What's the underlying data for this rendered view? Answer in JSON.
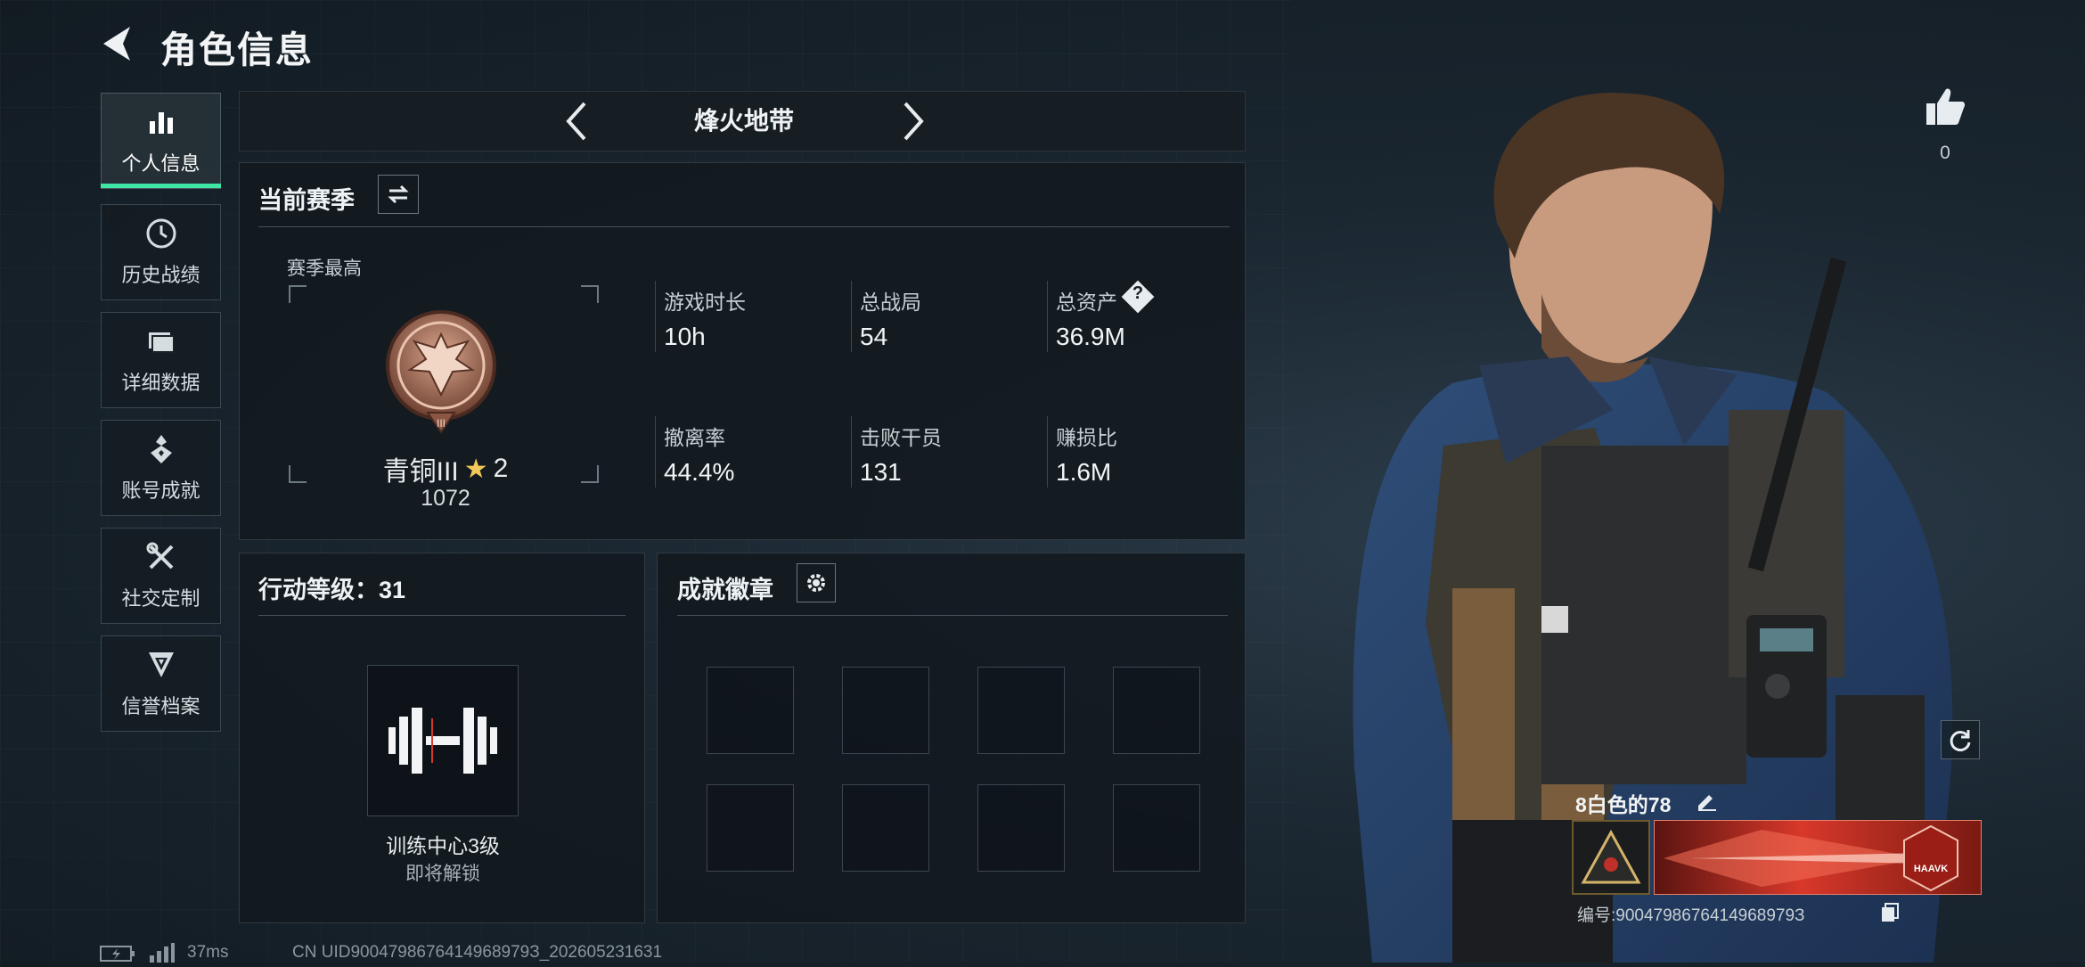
{
  "header": {
    "title": "角色信息"
  },
  "sidebar": {
    "items": [
      {
        "label": "个人信息",
        "icon": "bar-chart-icon"
      },
      {
        "label": "历史战绩",
        "icon": "clock-icon"
      },
      {
        "label": "详细数据",
        "icon": "folder-icon"
      },
      {
        "label": "账号成就",
        "icon": "medal-icon"
      },
      {
        "label": "社交定制",
        "icon": "tools-icon"
      },
      {
        "label": "信誉档案",
        "icon": "shield-icon"
      }
    ]
  },
  "mode": {
    "title": "烽火地带"
  },
  "season": {
    "title": "当前赛季",
    "best_label": "赛季最高",
    "rank_name": "青铜III",
    "rank_stars": "2",
    "rank_points": "1072",
    "stats": [
      {
        "label": "游戏时长",
        "value": "10h"
      },
      {
        "label": "总战局",
        "value": "54"
      },
      {
        "label": "总资产",
        "value": "36.9M"
      },
      {
        "label": "撤离率",
        "value": "44.4%"
      },
      {
        "label": "击败干员",
        "value": "131"
      },
      {
        "label": "赚损比",
        "value": "1.6M"
      }
    ]
  },
  "level": {
    "title": "行动等级：31",
    "item_name": "训练中心3级",
    "item_status": "即将解锁"
  },
  "badges": {
    "title": "成就徽章"
  },
  "likes": {
    "count": "0"
  },
  "player": {
    "name": "8白色的78",
    "id_text": "编号:9004798676414968979З",
    "card_brand": "HAAVK"
  },
  "status_bar": {
    "ping": "37ms",
    "uid": "CN UID9004798676414968979З_202605231631"
  },
  "colors": {
    "accent": "#3ee6a6",
    "bronze": "#a8705a",
    "card_red": "#d8382a"
  }
}
